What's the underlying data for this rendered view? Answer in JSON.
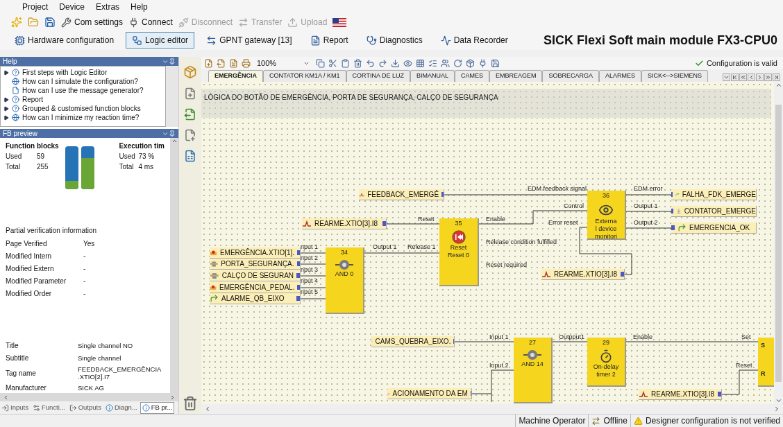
{
  "menu": [
    "Project",
    "Device",
    "Extras",
    "Help"
  ],
  "toolbar": [
    {
      "label": "Com settings",
      "kind": "wrench",
      "disabled": false
    },
    {
      "label": "Connect",
      "kind": "connect",
      "disabled": false
    },
    {
      "label": "Disconnect",
      "kind": "disconnect",
      "disabled": true
    },
    {
      "label": "Transfer",
      "kind": "transfer",
      "disabled": true
    },
    {
      "label": "Upload",
      "kind": "upload",
      "disabled": true
    }
  ],
  "views": [
    {
      "label": "Hardware configuration",
      "kind": "hardware",
      "selected": false
    },
    {
      "label": "Logic editor",
      "kind": "logic",
      "selected": true
    },
    {
      "label": "GPNT gateway [13]",
      "kind": "gateway",
      "selected": false
    },
    {
      "label": "Report",
      "kind": "report",
      "selected": false
    },
    {
      "label": "Diagnostics",
      "kind": "diagnostics",
      "selected": false
    },
    {
      "label": "Data Recorder",
      "kind": "recorder",
      "selected": false
    }
  ],
  "module_title": "SICK Flexi Soft main module FX3-CPU0",
  "help": {
    "title": "Help",
    "items": [
      {
        "label": "First steps with Logic Editor",
        "kind": "question",
        "expandable": true
      },
      {
        "label": "How can I simulate the configuration?",
        "kind": "globe",
        "expandable": false
      },
      {
        "label": "How can I use the message generator?",
        "kind": "doc",
        "expandable": false
      },
      {
        "label": "Report",
        "kind": "question",
        "expandable": true
      },
      {
        "label": "Grouped & customised function blocks",
        "kind": "question",
        "expandable": true
      },
      {
        "label": "How can I minimize my reaction time?",
        "kind": "globe",
        "expandable": true
      }
    ]
  },
  "fb_preview": {
    "title": "FB preview",
    "function_blocks": {
      "heading": "Function blocks",
      "rows": [
        {
          "label": "Used",
          "value": "59"
        },
        {
          "label": "Total",
          "value": "255"
        }
      ]
    },
    "execution_time": {
      "heading": "Execution tim",
      "rows": [
        {
          "label": "Used",
          "value": "73 %"
        },
        {
          "label": "Total",
          "value": "4 ms"
        }
      ]
    },
    "usage_bars": [
      {
        "level": 0.2
      },
      {
        "level": 0.73
      }
    ],
    "verification": {
      "title": "Partial verification information",
      "rows": [
        {
          "label": "Page Verified",
          "value": "Yes"
        },
        {
          "label": "Modified Intern",
          "value": "-"
        },
        {
          "label": "Modified Extern",
          "value": "-"
        },
        {
          "label": "Modified Parameter",
          "value": "-"
        },
        {
          "label": "Modified Order",
          "value": "-"
        }
      ]
    },
    "properties": [
      {
        "label": "Title",
        "value": "Single channel NO"
      },
      {
        "label": "Subtitle",
        "value": "Single channel"
      },
      {
        "label": "Tag name",
        "value": "FEEDBACK_EMERGÊNCIA .XTIO[2].I7"
      },
      {
        "label": "Manufacturer",
        "value": "SICK AG"
      }
    ]
  },
  "panel_tabs": [
    {
      "label": "Inputs",
      "kind": "inputs",
      "selected": false
    },
    {
      "label": "Functi...",
      "kind": "functions",
      "selected": false
    },
    {
      "label": "Outputs",
      "kind": "outputs",
      "selected": false
    },
    {
      "label": "Diagn...",
      "kind": "info",
      "selected": false
    },
    {
      "label": "FB pr...",
      "kind": "info",
      "selected": true
    }
  ],
  "editor": {
    "zoom": "100%",
    "status": "Configuration is valid"
  },
  "pages": [
    {
      "label": "EMERGÊNCIA",
      "selected": true
    },
    {
      "label": "CONTATOR KM1A / KM1",
      "selected": false
    },
    {
      "label": "CORTINA DE LUZ",
      "selected": false
    },
    {
      "label": "BIMANUAL",
      "selected": false
    },
    {
      "label": "CAMES",
      "selected": false
    },
    {
      "label": "EMBREAGEM",
      "selected": false
    },
    {
      "label": "SOBRECARGA",
      "selected": false
    },
    {
      "label": "ALARMES",
      "selected": false
    },
    {
      "label": "SICK<-->SIEMENS",
      "selected": false
    }
  ],
  "page_title": "LÓGICA DO BOTÃO DE EMERGÊNCIA, PORTA DE SEGURANÇA, CALÇO DE SEGURANÇA",
  "tags": [
    {
      "label": "FEEDBACK_EMERGÊ",
      "kind": "signal"
    },
    {
      "label": "REARME.XTIO[3].I8",
      "kind": "signal"
    },
    {
      "label": "EMERGÊNCIA.XTIO[1].",
      "kind": "estop"
    },
    {
      "label": "PORTA_SEGURANÇA.",
      "kind": "switch"
    },
    {
      "label": "CALÇO DE SEGURAN",
      "kind": "switch"
    },
    {
      "label": "EMERGÊNCIA_PEDAL.",
      "kind": "estop"
    },
    {
      "label": "ALARME_QB_EIXO",
      "kind": "output"
    },
    {
      "label": "FALHA_FDK_EMERGE",
      "kind": "output"
    },
    {
      "label": "CONTATOR_EMERGE",
      "kind": "contactor"
    },
    {
      "label": "EMERGENCIA_OK",
      "kind": "output"
    },
    {
      "label": "REARME.XTIO[3].I8",
      "kind": "signal"
    },
    {
      "label": "CAMS_QUEBRA_EIXO.",
      "kind": "cam"
    },
    {
      "label": "ACIONAMENTO DA EM",
      "kind": "signal"
    },
    {
      "label": "REARME.XTIO[3].I8",
      "kind": "signal"
    }
  ],
  "blocks": [
    {
      "number": "34",
      "lines": [
        "AND 0"
      ],
      "kind": "and"
    },
    {
      "number": "35",
      "lines": [
        "Reset",
        "Reset 0"
      ],
      "kind": "reset"
    },
    {
      "number": "36",
      "lines": [
        "Externa",
        "l device",
        "monitori"
      ],
      "kind": "edm"
    },
    {
      "number": "27",
      "lines": [
        "AND 14"
      ],
      "kind": "and"
    },
    {
      "number": "29",
      "lines": [
        "On-delay",
        "timer 2"
      ],
      "kind": "timer"
    },
    {
      "lines": [
        "S",
        "R"
      ],
      "kind": "flipflop"
    }
  ],
  "port_labels": [
    "EDM feedback signal",
    "Control",
    "Error reset",
    "Reset",
    "Enable",
    "Release condition fulfilled",
    "Reset required",
    "nput 1",
    "Output 1",
    "Release 1",
    "nput 2",
    "nput 3",
    "nput 4",
    "nput 5",
    "EDM error",
    "Output 1",
    "Output 2",
    "Input 1",
    "Input 2",
    "Outpput1",
    "Enable",
    "Set",
    "Reset"
  ],
  "status_bar": [
    {
      "label": "Machine Operator",
      "kind": "text"
    },
    {
      "label": "Offline",
      "kind": "offline"
    },
    {
      "label": "Designer configuration is not verified",
      "kind": "warning"
    }
  ]
}
